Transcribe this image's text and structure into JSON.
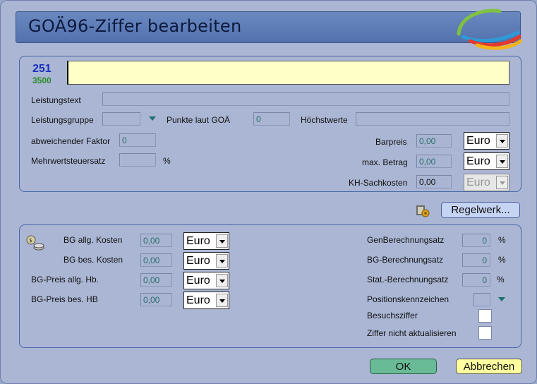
{
  "dialog": {
    "title": "GOÄ96-Ziffer bearbeiten"
  },
  "header_icon": {
    "digits_top": "251",
    "digits_bottom": "3500"
  },
  "top": {
    "ziffer_value": "",
    "leistungstext_label": "Leistungstext",
    "leistungsgruppe_label": "Leistungsgruppe",
    "punkte_label": "Punkte laut GOÄ",
    "punkte_value": "0",
    "hoechstwerte_label": "Höchstwerte",
    "faktor_label": "abweichender Faktor",
    "faktor_value": "0",
    "mwst_label": "Mehrwertsteuersatz",
    "mwst_unit": "%",
    "barpreis_label": "Barpreis",
    "barpreis_value": "0,00",
    "maxbetrag_label": "max. Betrag",
    "maxbetrag_value": "0,00",
    "kh_label": "KH-Sachkosten",
    "kh_value": "0,00",
    "currency": "Euro"
  },
  "regelwerk_label": "Regelwerk...",
  "bottom": {
    "bg_allg_kosten_label": "BG allg. Kosten",
    "bg_allg_kosten_value": "0,00",
    "bg_bes_kosten_label": "BG bes. Kosten",
    "bg_bes_kosten_value": "0,00",
    "bg_preis_allg_label": "BG-Preis allg. Hb.",
    "bg_preis_allg_value": "0,00",
    "bg_preis_bes_label": "BG-Preis bes. HB",
    "bg_preis_bes_value": "0,00",
    "currency": "Euro",
    "gen_label": "GenBerechnungsatz",
    "gen_value": "0",
    "bg_satz_label": "BG-Berechnungsatz",
    "bg_satz_value": "0",
    "stat_label": "Stat.-Berechnungsatz",
    "stat_value": "0",
    "percent": "%",
    "positionskennzeichen_label": "Positionskennzeichen",
    "besuchsziffer_label": "Besuchsziffer",
    "nicht_aktualisieren_label": "Ziffer nicht aktualisieren"
  },
  "buttons": {
    "ok": "OK",
    "cancel": "Abbrechen"
  },
  "colors": {
    "title_bg": "#5b79b3",
    "yellow_field": "#ffffc8",
    "ok_bg": "#69bb95",
    "cancel_bg": "#ffffa0"
  }
}
